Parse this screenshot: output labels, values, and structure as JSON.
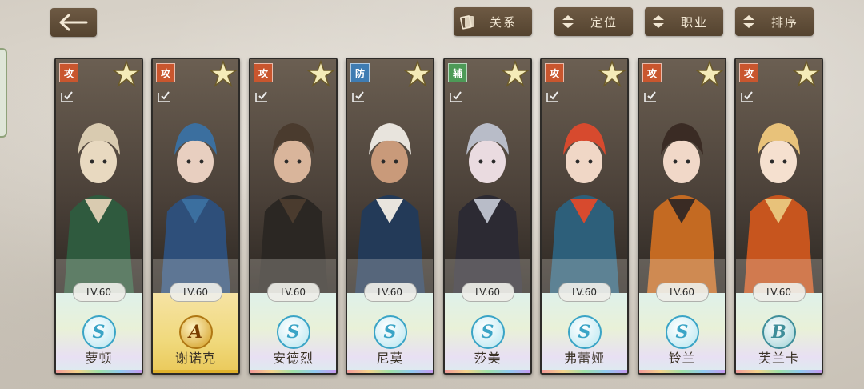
{
  "nav": {
    "back_icon": "arrow-left-icon",
    "buttons": [
      {
        "key": "relation",
        "label": "关系",
        "icon": "card-stack-icon"
      },
      {
        "key": "position",
        "label": "定位",
        "icon": "up-down-sort-icon"
      },
      {
        "key": "job",
        "label": "职业",
        "icon": "up-down-sort-icon"
      },
      {
        "key": "sort",
        "label": "排序",
        "icon": "up-down-sort-icon"
      }
    ]
  },
  "colors": {
    "attack": "#c9562e",
    "defense": "#3f7cb2",
    "support": "#4d9a57",
    "rank_s": "#3aa4c6",
    "rank_a": "#d09a1c",
    "rank_b": "#3f8e9a"
  },
  "characters": [
    {
      "name": "萝顿",
      "level": "LV.60",
      "role": "攻",
      "rank": "S"
    },
    {
      "name": "谢诺克",
      "level": "LV.60",
      "role": "攻",
      "rank": "A"
    },
    {
      "name": "安德烈",
      "level": "LV.60",
      "role": "攻",
      "rank": "S"
    },
    {
      "name": "尼莫",
      "level": "LV.60",
      "role": "防",
      "rank": "S"
    },
    {
      "name": "莎美",
      "level": "LV.60",
      "role": "辅",
      "rank": "S"
    },
    {
      "name": "弗蕾娅",
      "level": "LV.60",
      "role": "攻",
      "rank": "S"
    },
    {
      "name": "铃兰",
      "level": "LV.60",
      "role": "攻",
      "rank": "S"
    },
    {
      "name": "芙兰卡",
      "level": "LV.60",
      "role": "攻",
      "rank": "B"
    }
  ]
}
